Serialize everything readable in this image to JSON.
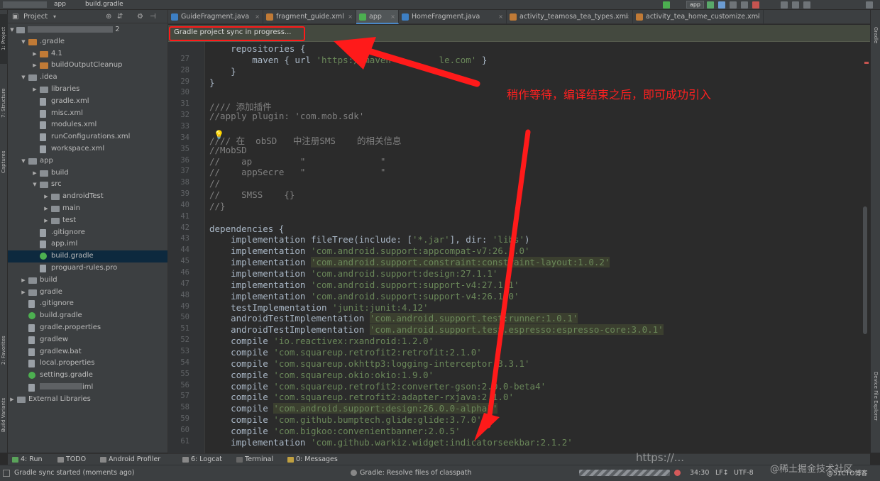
{
  "toolbar": {
    "breadcrumb_module": "app",
    "breadcrumb_file": "build.gradle",
    "run_config": "app"
  },
  "side_tabs": {
    "project": "1: Project",
    "structure": "7: Structure",
    "captures": "Captures",
    "favorites": "2: Favorites",
    "build_variants": "Build Variants",
    "gradle": "Gradle",
    "device_file_explorer": "Device File Explorer"
  },
  "project_panel": {
    "title": "Project",
    "root_suffix": "2",
    "items": [
      {
        "label": ".gradle",
        "depth": 1,
        "open": true,
        "icon": "folder-orange"
      },
      {
        "label": "4.1",
        "depth": 2,
        "open": false,
        "icon": "folder-orange"
      },
      {
        "label": "buildOutputCleanup",
        "depth": 2,
        "open": false,
        "icon": "folder-orange"
      },
      {
        "label": ".idea",
        "depth": 1,
        "open": true,
        "icon": "folder"
      },
      {
        "label": "libraries",
        "depth": 2,
        "open": false,
        "icon": "folder"
      },
      {
        "label": "gradle.xml",
        "depth": 2,
        "icon": "file"
      },
      {
        "label": "misc.xml",
        "depth": 2,
        "icon": "file"
      },
      {
        "label": "modules.xml",
        "depth": 2,
        "icon": "file"
      },
      {
        "label": "runConfigurations.xml",
        "depth": 2,
        "icon": "file"
      },
      {
        "label": "workspace.xml",
        "depth": 2,
        "icon": "file"
      },
      {
        "label": "app",
        "depth": 1,
        "open": true,
        "icon": "folder"
      },
      {
        "label": "build",
        "depth": 2,
        "open": false,
        "icon": "folder"
      },
      {
        "label": "src",
        "depth": 2,
        "open": true,
        "icon": "folder"
      },
      {
        "label": "androidTest",
        "depth": 3,
        "open": false,
        "icon": "folder"
      },
      {
        "label": "main",
        "depth": 3,
        "open": false,
        "icon": "folder"
      },
      {
        "label": "test",
        "depth": 3,
        "open": false,
        "icon": "folder"
      },
      {
        "label": ".gitignore",
        "depth": 2,
        "icon": "file"
      },
      {
        "label": "app.iml",
        "depth": 2,
        "icon": "file"
      },
      {
        "label": "build.gradle",
        "depth": 2,
        "icon": "gradle",
        "selected": true
      },
      {
        "label": "proguard-rules.pro",
        "depth": 2,
        "icon": "file"
      },
      {
        "label": "build",
        "depth": 1,
        "open": false,
        "icon": "folder"
      },
      {
        "label": "gradle",
        "depth": 1,
        "open": false,
        "icon": "folder"
      },
      {
        "label": ".gitignore",
        "depth": 1,
        "icon": "file"
      },
      {
        "label": "build.gradle",
        "depth": 1,
        "icon": "gradle"
      },
      {
        "label": "gradle.properties",
        "depth": 1,
        "icon": "file"
      },
      {
        "label": "gradlew",
        "depth": 1,
        "icon": "file"
      },
      {
        "label": "gradlew.bat",
        "depth": 1,
        "icon": "file"
      },
      {
        "label": "local.properties",
        "depth": 1,
        "icon": "file"
      },
      {
        "label": "settings.gradle",
        "depth": 1,
        "icon": "gradle"
      },
      {
        "label": "iml",
        "depth": 1,
        "icon": "file",
        "blurred_prefix": true
      },
      {
        "label": "External Libraries",
        "depth": 0,
        "open": false,
        "icon": "folder"
      }
    ]
  },
  "tabs": [
    {
      "label": "GuideFragment.java",
      "color": "#3d7fc4"
    },
    {
      "label": "fragment_guide.xml",
      "color": "#c07a36"
    },
    {
      "label": "app",
      "color": "#4caf50",
      "active": true
    },
    {
      "label": "HomeFragment.java",
      "color": "#3d7fc4"
    },
    {
      "label": "activity_teamosa_tea_types.xml",
      "color": "#c07a36"
    },
    {
      "label": "activity_tea_home_customize.xml",
      "color": "#c07a36"
    }
  ],
  "banner": {
    "text": "Gradle project sync in progress..."
  },
  "code_lines": [
    {
      "n": "",
      "html": "    <span class='fn'>repositories {</span>"
    },
    {
      "n": "27",
      "html": "        maven { <span class='fn'>url</span> <span class='str'>'https://maven         le.com'</span> }"
    },
    {
      "n": "28",
      "html": "    }"
    },
    {
      "n": "29",
      "html": "}"
    },
    {
      "n": "30",
      "html": ""
    },
    {
      "n": "31",
      "html": "<span class='cmt'>//// 添加插件</span>"
    },
    {
      "n": "32",
      "html": "<span class='cmt'>//apply plugin: 'com.mob.sdk'</span>"
    },
    {
      "n": "33",
      "html": ""
    },
    {
      "n": "34",
      "html": "<span class='cmt'>//// 在  obSD   中注册SMS    的相关信息</span>"
    },
    {
      "n": "35",
      "html": "<span class='cmt'>//MobSD</span>"
    },
    {
      "n": "36",
      "html": "<span class='cmt'>//    ap         \"              \"</span>"
    },
    {
      "n": "37",
      "html": "<span class='cmt'>//    appSecre   \"              \"</span>"
    },
    {
      "n": "38",
      "html": "<span class='cmt'>//</span>"
    },
    {
      "n": "39",
      "html": "<span class='cmt'>//    SMSS    {}</span>"
    },
    {
      "n": "40",
      "html": "<span class='cmt'>//}</span>"
    },
    {
      "n": "41",
      "html": ""
    },
    {
      "n": "42",
      "html": "<span class='fn'>dependencies</span> {"
    },
    {
      "n": "43",
      "html": "    implementation fileTree(<span class='fn'>include</span>: [<span class='str'>'*.jar'</span>], <span class='fn'>dir</span>: <span class='str'>'libs'</span>)"
    },
    {
      "n": "44",
      "html": "    implementation <span class='str'>'com.android.support:appcompat-v7:26.1.0'</span>"
    },
    {
      "n": "45",
      "html": "    implementation <span class='str hl'>'com.android.support.constraint:constraint-layout:1.0.2'</span>"
    },
    {
      "n": "46",
      "html": "    implementation <span class='str'>'com.android.support:design:27.1.1'</span>"
    },
    {
      "n": "47",
      "html": "    implementation <span class='str'>'com.android.support:support-v4:27.1.1'</span>"
    },
    {
      "n": "48",
      "html": "    implementation <span class='str'>'com.android.support:support-v4:26.1.0'</span>"
    },
    {
      "n": "49",
      "html": "    testImplementation <span class='str'>'junit:junit:4.12'</span>"
    },
    {
      "n": "50",
      "html": "    androidTestImplementation <span class='str hl'>'com.android.support.test:runner:1.0.1'</span>"
    },
    {
      "n": "51",
      "html": "    androidTestImplementation <span class='str hl'>'com.android.support.test.espresso:espresso-core:3.0.1'</span>"
    },
    {
      "n": "52",
      "html": "    compile <span class='str'>'io.reactivex:rxandroid:1.2.0'</span>"
    },
    {
      "n": "53",
      "html": "    compile <span class='str'>'com.squareup.retrofit2:retrofit:2.1.0'</span>"
    },
    {
      "n": "54",
      "html": "    compile <span class='str'>'com.squareup.okhttp3:logging-interceptor:3.3.1'</span>"
    },
    {
      "n": "55",
      "html": "    compile <span class='str'>'com.squareup.okio:okio:1.9.0'</span>"
    },
    {
      "n": "56",
      "html": "    compile <span class='str'>'com.squareup.retrofit2:converter-gson:2.0.0-beta4'</span>"
    },
    {
      "n": "57",
      "html": "    compile <span class='str'>'com.squareup.retrofit2:adapter-rxjava:2.1.0'</span>"
    },
    {
      "n": "58",
      "html": "    compile <span class='str hl'>'com.android.support:design:26.0.0-alpha1'</span>"
    },
    {
      "n": "59",
      "html": "    compile <span class='str'>'com.github.bumptech.glide:glide:3.7.0'</span>"
    },
    {
      "n": "60",
      "html": "    compile <span class='str'>'com.bigkoo:convenientbanner:2.0.5'</span>"
    },
    {
      "n": "61",
      "html": "    implementation <span class='str'>'com.github.warkiz.widget:indicatorseekbar:2.1.2'</span>"
    }
  ],
  "annotation": "稍作等待，编译结束之后，即可成功引入",
  "bottom_tools": [
    {
      "label": "4: Run",
      "color": "#5aa35a"
    },
    {
      "label": "TODO",
      "color": "#888"
    },
    {
      "label": "Android Profiler",
      "color": "#888"
    },
    {
      "label": "6: Logcat",
      "color": "#888"
    },
    {
      "label": "Terminal",
      "color": "#666"
    },
    {
      "label": "0: Messages",
      "color": "#c0a040"
    }
  ],
  "status": {
    "left_text": "Gradle sync started (moments ago)",
    "task_text": "Gradle: Resolve files of classpath",
    "position": "34:30",
    "line_sep": "LF↕",
    "encoding": "UTF-8"
  },
  "watermarks": {
    "overlay": "https://...",
    "site1": "@稀土掘金技术社区",
    "site2": "@51CTO博客"
  },
  "colors": {
    "annotation_red": "#ff1a1a",
    "selection": "#0d293e",
    "banner_bg": "#44493f"
  }
}
